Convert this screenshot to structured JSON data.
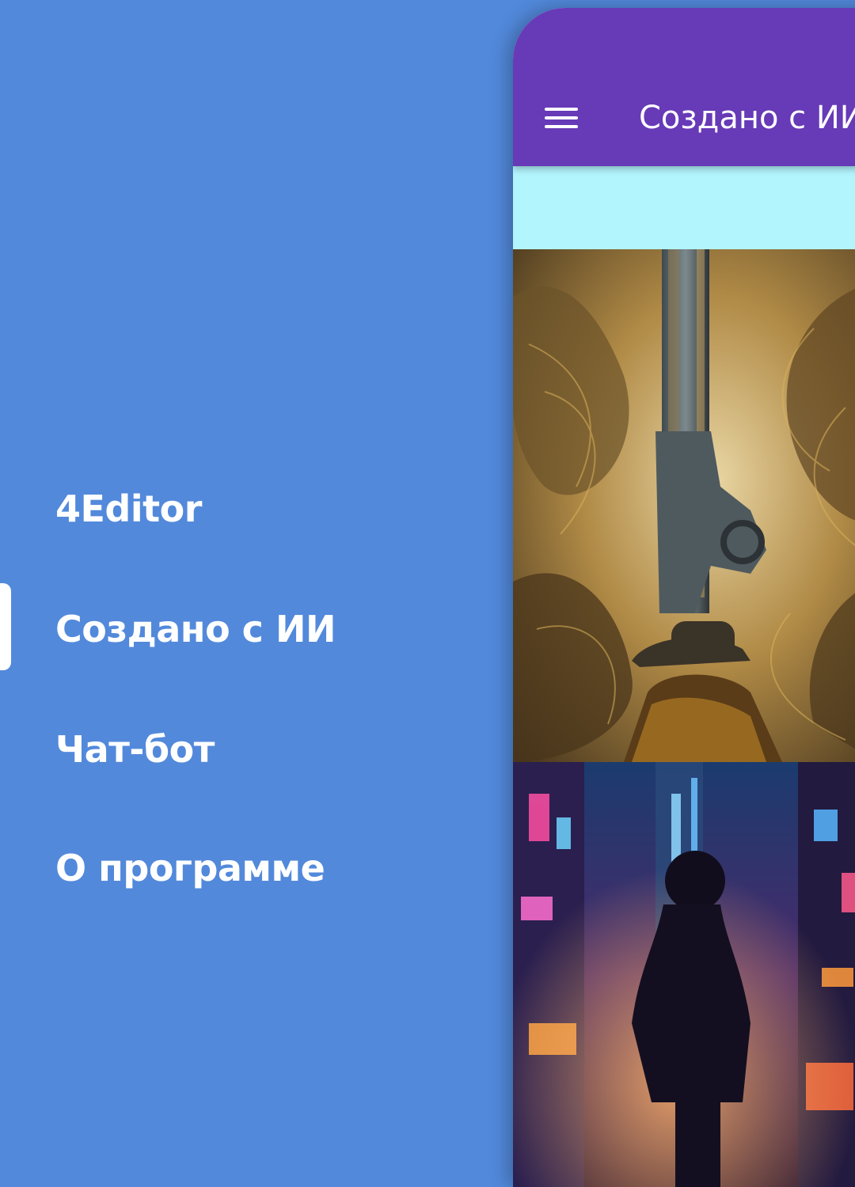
{
  "drawer": {
    "items": [
      {
        "label": "4Editor",
        "active": false
      },
      {
        "label": "Создано с ИИ",
        "active": true
      },
      {
        "label": "Чат-бот",
        "active": false
      },
      {
        "label": "О программе",
        "active": false
      }
    ]
  },
  "appbar": {
    "title": "Создано с ИИ",
    "menu_icon": "hamburger-menu-icon",
    "color": "#673ab7"
  },
  "colors": {
    "drawer_background": "#5289db",
    "banner_background": "#b2f5fd",
    "drawer_text": "#ffffff"
  },
  "gallery": {
    "images": [
      {
        "subject": "ai-art-cowboy-with-giant-rifle"
      },
      {
        "subject": "ai-art-child-in-neon-city"
      }
    ]
  }
}
